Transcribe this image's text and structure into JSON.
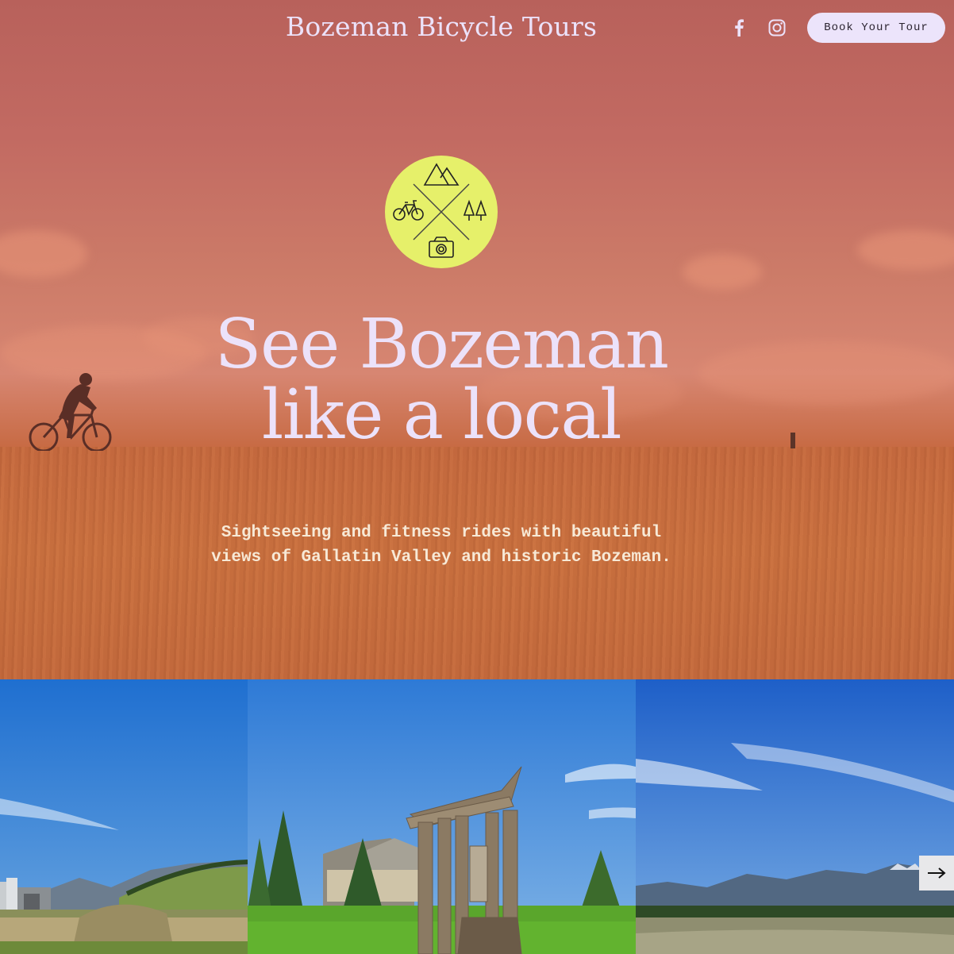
{
  "header": {
    "brand": "Bozeman Bicycle Tours",
    "book_label": "Book Your Tour",
    "social": [
      {
        "icon": "facebook-icon"
      },
      {
        "icon": "instagram-icon"
      }
    ]
  },
  "hero": {
    "headline_line1": "See Bozeman",
    "headline_line2": "like a local",
    "subtitle": "Sightseeing and fitness rides with beautiful views of Gallatin Valley and historic Bozeman.",
    "emblem_icons": [
      "mountains-icon",
      "bicycle-icon",
      "trees-icon",
      "camera-icon"
    ]
  },
  "gallery": {
    "photos": [
      "grain-elevator-photo",
      "wooden-sculpture-photo",
      "mountain-valley-photo"
    ],
    "next_icon": "arrow-right-icon"
  },
  "colors": {
    "hero_overlay": "#c8683f",
    "text_light": "#ece2fa",
    "emblem": "#e6f06a",
    "button_bg": "#ece4fb"
  }
}
